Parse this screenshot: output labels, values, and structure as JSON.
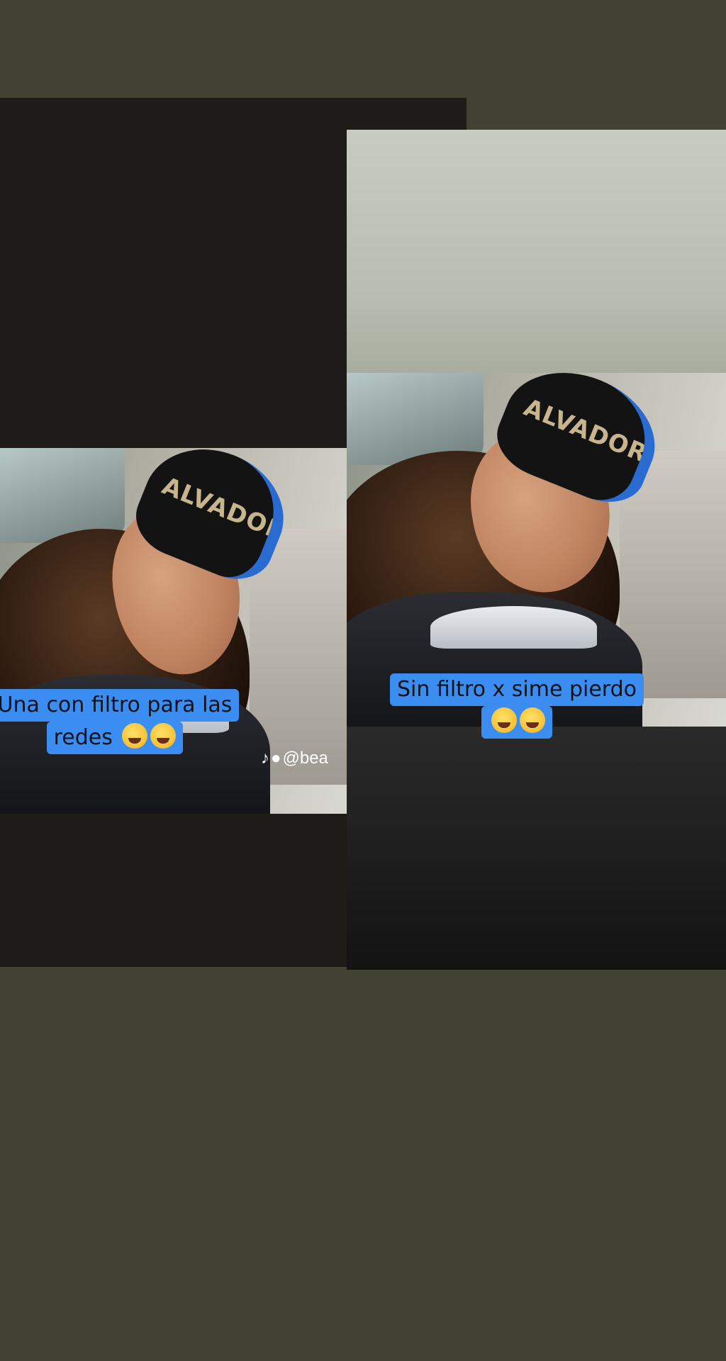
{
  "colors": {
    "background": "#414232",
    "caption_bg": "#3b8df1",
    "caption_text": "#101418"
  },
  "left": {
    "photo_hat_text": "ALVADOR",
    "caption_line1": "Una con filtro para las",
    "caption_line2": "redes"
  },
  "right": {
    "photo_hat_text": "ALVADOR",
    "caption_line1": "Sin filtro x sime pierdo"
  },
  "emojis": [
    "grinning-sweat-emoji",
    "winking-tongue-emoji"
  ],
  "watermark": {
    "icons": [
      "tiktok-icon",
      "person-icon"
    ],
    "text": "@bea"
  }
}
